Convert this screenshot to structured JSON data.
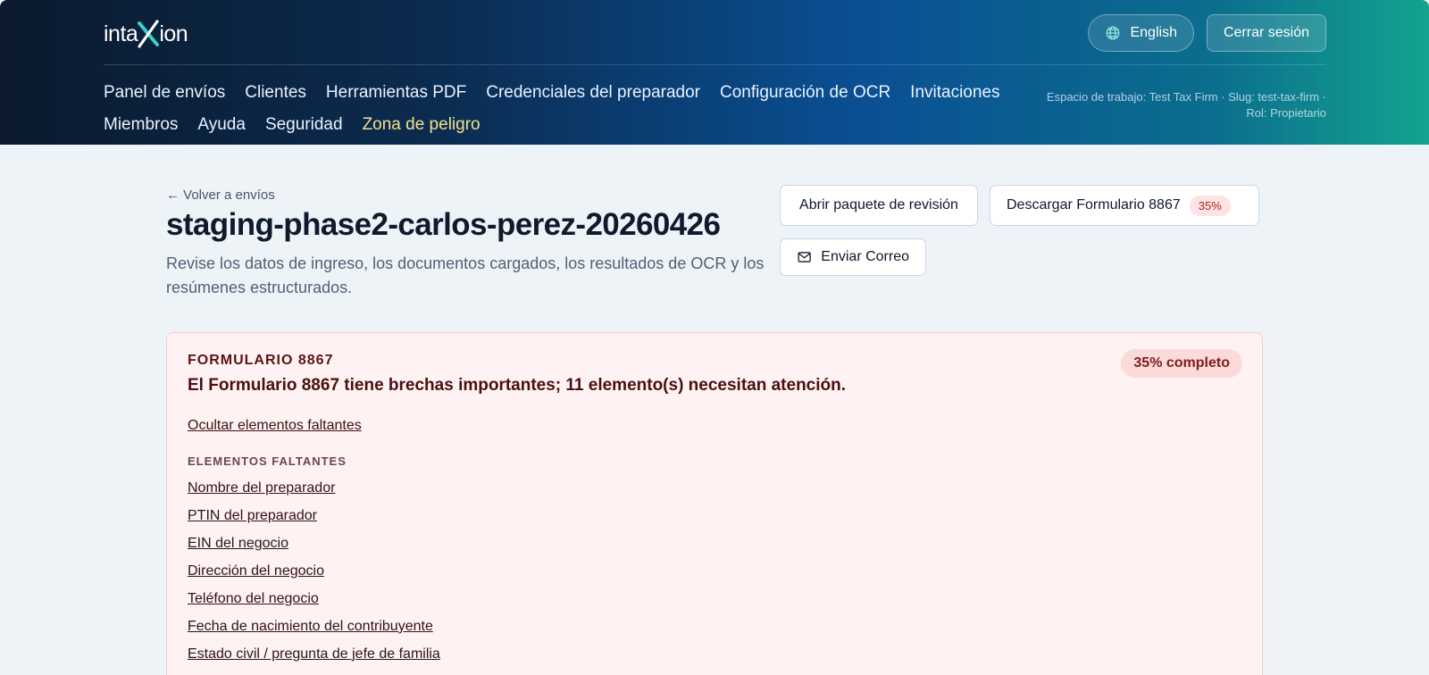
{
  "brand": {
    "logo_text_left": "inta",
    "logo_text_right": "ion"
  },
  "header": {
    "language_label": "English",
    "logout_label": "Cerrar sesión",
    "workspace_info": "Espacio de trabajo: Test Tax Firm · Slug: test-tax-firm · Rol: Propietario"
  },
  "nav": {
    "row1": [
      "Panel de envíos",
      "Clientes",
      "Herramientas PDF",
      "Credenciales del preparador",
      "Configuración de OCR",
      "Invitaciones"
    ],
    "row2": [
      "Miembros",
      "Ayuda",
      "Seguridad",
      "Zona de peligro"
    ]
  },
  "main": {
    "back_label": "← Volver a envíos",
    "title": "staging-phase2-carlos-perez-20260426",
    "subtitle": "Revise los datos de ingreso, los documentos cargados, los resultados de OCR y los resúmenes estructurados.",
    "review_button": "Abrir paquete de revisión",
    "download_button": "Descargar Formulario 8867",
    "download_pct": "35%",
    "email_button": "Enviar Correo"
  },
  "alert": {
    "eyebrow": "FORMULARIO 8867",
    "headline": "El Formulario 8867 tiene brechas importantes; 11 elemento(s) necesitan atención.",
    "complete_badge": "35% completo",
    "toggle_label": "Ocultar elementos faltantes",
    "missing_label": "ELEMENTOS FALTANTES",
    "missing_items": [
      "Nombre del preparador",
      "PTIN del preparador",
      "EIN del negocio",
      "Dirección del negocio",
      "Teléfono del negocio",
      "Fecha de nacimiento del contribuyente",
      "Estado civil / pregunta de jefe de familia"
    ]
  },
  "colors": {
    "danger_nav": "#f3e18a",
    "alert_bg": "#fff2f2",
    "alert_border": "#f3cfc9",
    "pct_pill_bg": "#fde3e3"
  },
  "icons": {
    "language": "globe-icon",
    "email": "mail-icon",
    "logo_mark": "x-logo-icon"
  }
}
